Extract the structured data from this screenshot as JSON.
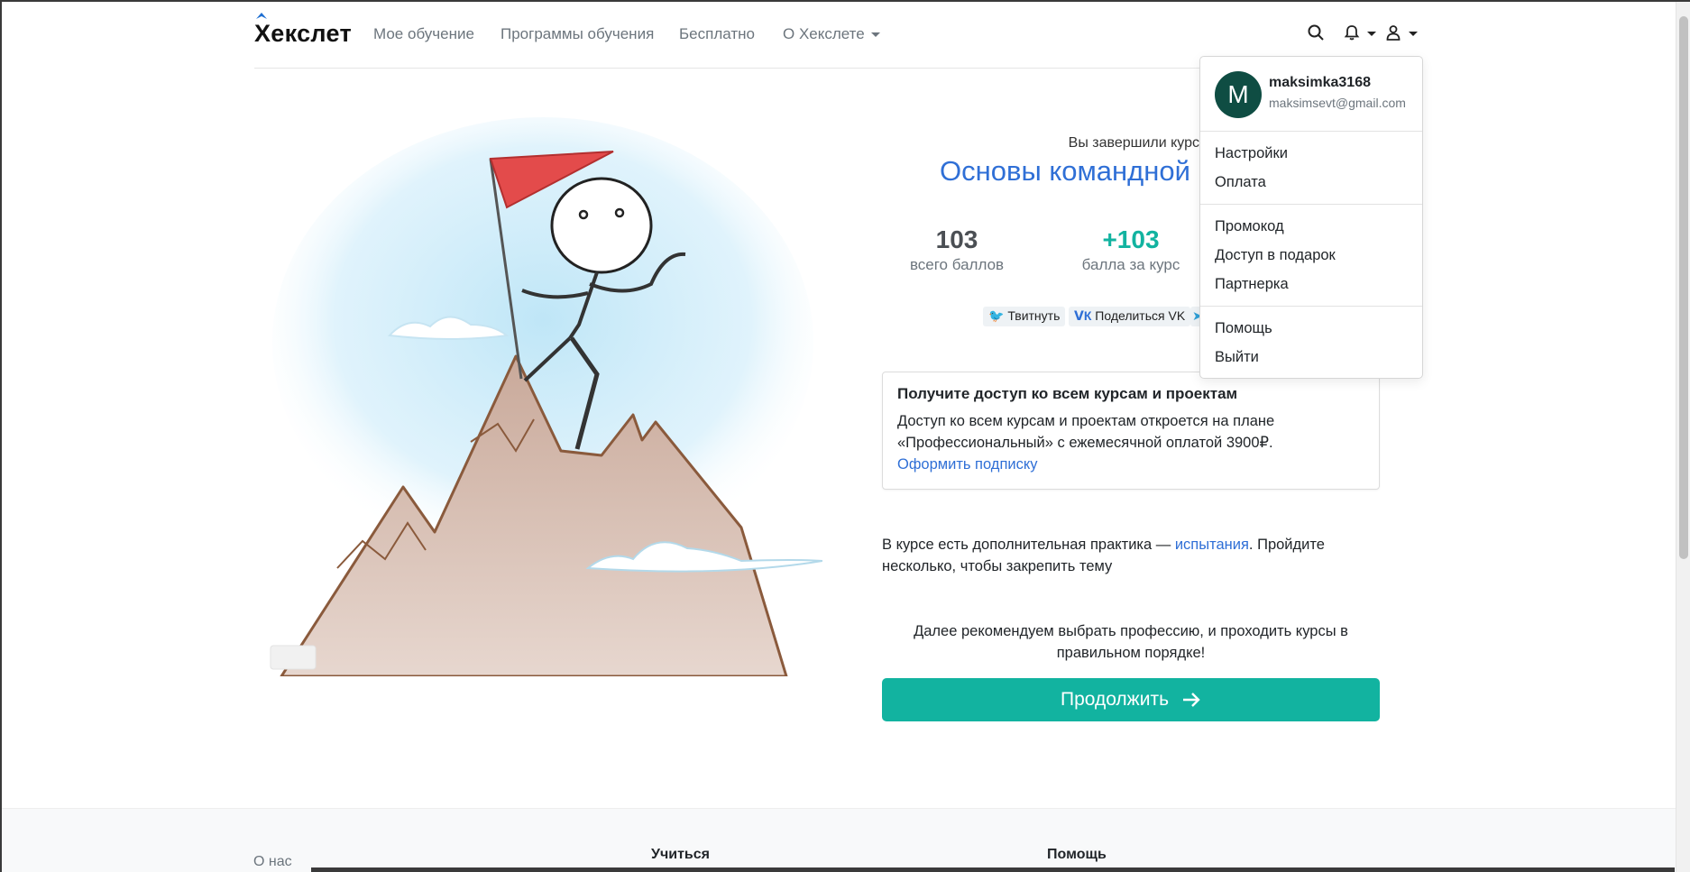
{
  "navbar": {
    "logo": "Хекслет",
    "links": [
      "Мое обучение",
      "Программы обучения",
      "Бесплатно",
      "О Хекслете"
    ]
  },
  "course": {
    "finished_label": "Вы завершили курс",
    "title": "Основы командной"
  },
  "stats": [
    {
      "value": "103",
      "label": "всего баллов"
    },
    {
      "value": "+103",
      "label": "балла за курс"
    }
  ],
  "share": {
    "twitter": "Твитнуть",
    "vk": "Поделиться VK"
  },
  "subscription": {
    "title": "Получите доступ ко всем курсам и проектам",
    "text_line1": "Доступ ко всем курсам и проектам откроется на плане",
    "text_line2": "«Профессиональный» с ежемесячной оплатой 3900₽.",
    "link": "Оформить подписку"
  },
  "practice": {
    "prefix": "В курсе есть дополнительная практика — ",
    "link": "испытания",
    "suffix": ". Пройдите несколько, чтобы закрепить тему"
  },
  "recommend": "Далее рекомендуем выбрать профессию, и проходить курсы в правильном порядке!",
  "continue_label": "Продолжить",
  "dropdown": {
    "avatar_letter": "M",
    "username": "maksimka3168",
    "email": "maksimsevt@gmail.com",
    "items": [
      "Настройки",
      "Оплата",
      "Промокод",
      "Доступ в подарок",
      "Партнерка",
      "Помощь",
      "Выйти"
    ]
  },
  "footer": {
    "links": [
      "О нас",
      "Учиться",
      "Помощь"
    ]
  },
  "colors": {
    "accent": "#12b3a0",
    "link": "#2f6fd6",
    "avatar": "#0f4d43"
  }
}
